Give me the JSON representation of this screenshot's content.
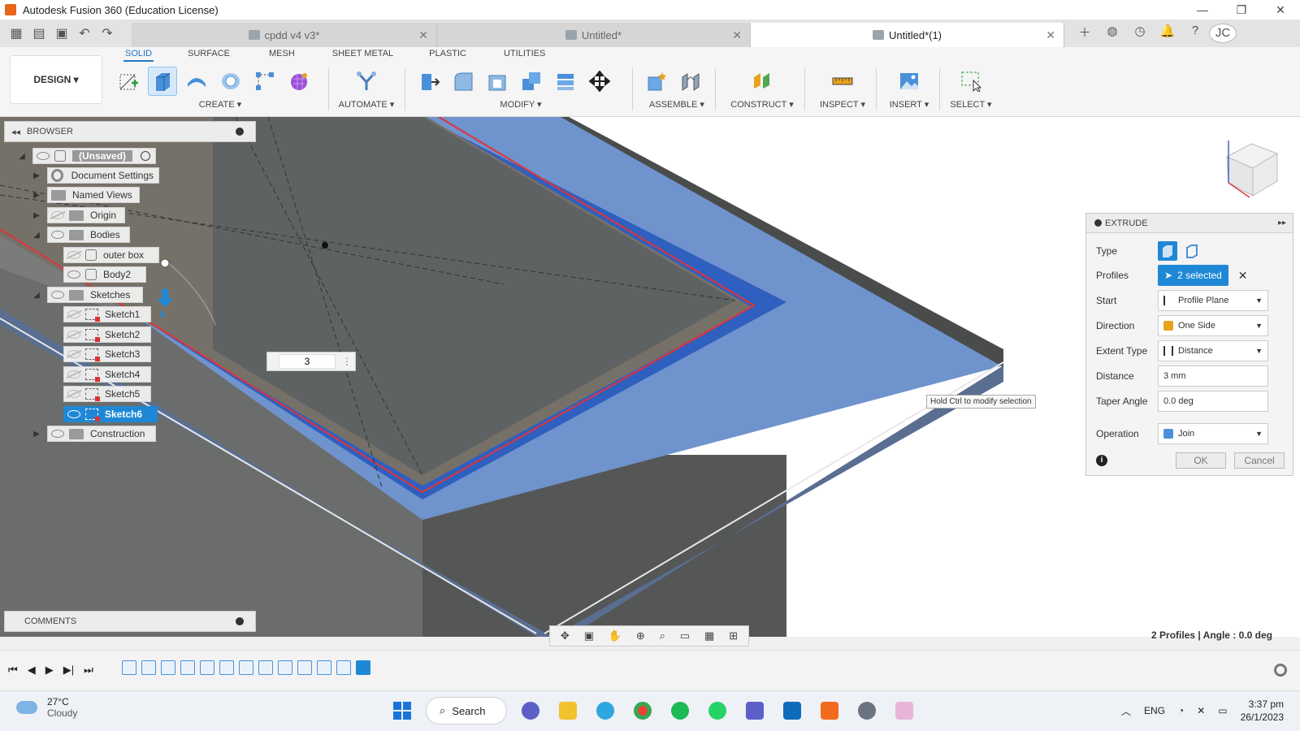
{
  "window": {
    "title": "Autodesk Fusion 360 (Education License)",
    "controls": [
      "—",
      "❐",
      "✕"
    ]
  },
  "doc_tabs": [
    {
      "label": "cpdd v4 v3*",
      "active": false
    },
    {
      "label": "Untitled*",
      "active": false
    },
    {
      "label": "Untitled*(1)",
      "active": true
    }
  ],
  "user_initials": "JC",
  "toolbar": {
    "workspace_button": "DESIGN ▾",
    "workspace_tabs": [
      "SOLID",
      "SURFACE",
      "MESH",
      "SHEET METAL",
      "PLASTIC",
      "UTILITIES"
    ],
    "active_tab": "SOLID",
    "groups": {
      "create": "CREATE ▾",
      "automate": "AUTOMATE ▾",
      "modify": "MODIFY ▾",
      "assemble": "ASSEMBLE ▾",
      "construct": "CONSTRUCT ▾",
      "inspect": "INSPECT ▾",
      "insert": "INSERT ▾",
      "select": "SELECT ▾"
    }
  },
  "browser": {
    "title": "BROWSER",
    "items": [
      {
        "label": "(Unsaved)"
      },
      {
        "label": "Document Settings"
      },
      {
        "label": "Named Views"
      },
      {
        "label": "Origin"
      },
      {
        "label": "Bodies"
      },
      {
        "label": "outer box"
      },
      {
        "label": "Body2"
      },
      {
        "label": "Sketches"
      },
      {
        "label": "Sketch1"
      },
      {
        "label": "Sketch2"
      },
      {
        "label": "Sketch3"
      },
      {
        "label": "Sketch4"
      },
      {
        "label": "Sketch5"
      },
      {
        "label": "Sketch6"
      },
      {
        "label": "Construction"
      }
    ]
  },
  "comments": {
    "title": "COMMENTS"
  },
  "distance_input": {
    "value": "3"
  },
  "tooltip": "Hold Ctrl to modify selection",
  "extrude": {
    "title": "EXTRUDE",
    "labels": {
      "type": "Type",
      "profiles": "Profiles",
      "start": "Start",
      "direction": "Direction",
      "extent_type": "Extent Type",
      "distance": "Distance",
      "taper_angle": "Taper Angle",
      "operation": "Operation"
    },
    "values": {
      "profiles": "2 selected",
      "start": "Profile Plane",
      "direction": "One Side",
      "extent_type": "Distance",
      "distance": "3 mm",
      "taper_angle": "0.0 deg",
      "operation": "Join"
    },
    "ok": "OK",
    "cancel": "Cancel"
  },
  "status": "2 Profiles | Angle : 0.0 deg",
  "taskbar": {
    "temperature": "27°C",
    "weather": "Cloudy",
    "search": "Search",
    "language": "ENG",
    "time": "3:37 pm",
    "date": "26/1/2023"
  },
  "colors": {
    "accent": "#1f88d6",
    "body_blue": "#6f93cc",
    "wall_grey": "#5f6060",
    "profile_red": "#e0333a"
  }
}
